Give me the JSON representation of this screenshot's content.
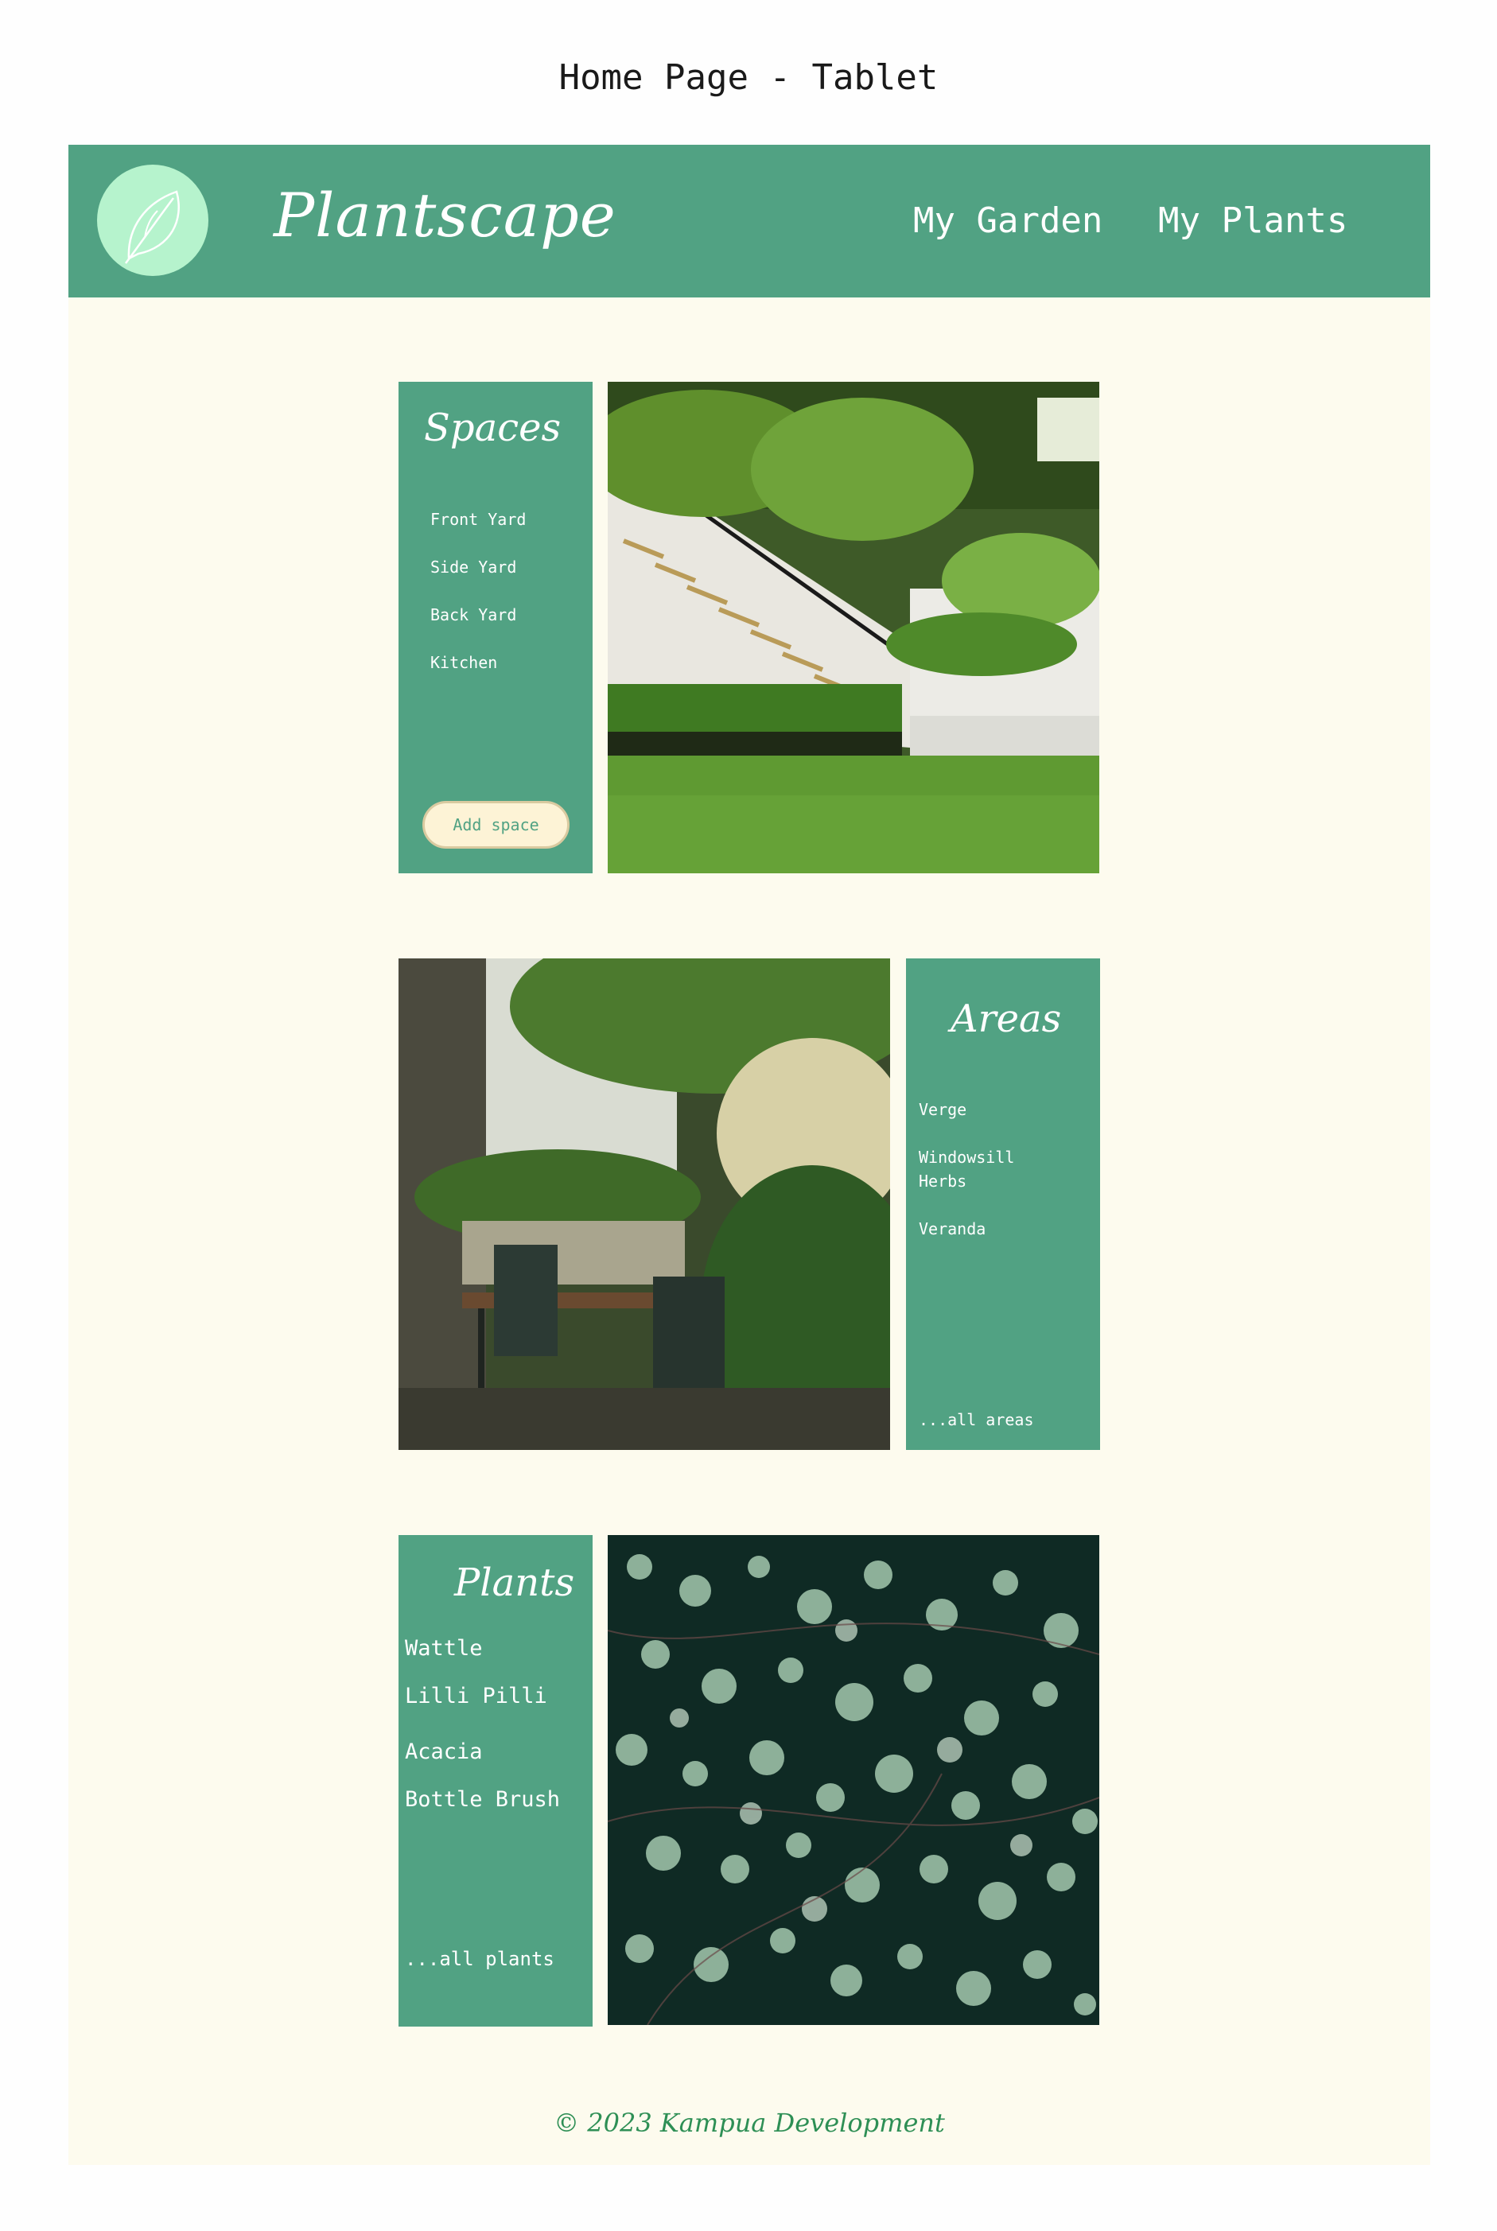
{
  "page_heading": "Home Page - Tablet",
  "header": {
    "brand": "Plantscape",
    "logo_icon": "leaf-icon",
    "nav": [
      {
        "label": "My Garden"
      },
      {
        "label": "My Plants"
      }
    ]
  },
  "spaces": {
    "title": "Spaces",
    "items": [
      "Front Yard",
      "Side Yard",
      "Back Yard",
      "Kitchen"
    ],
    "add_button": "Add space",
    "photo_icon": "garden-stairs-photo"
  },
  "areas": {
    "title": "Areas",
    "items": [
      "Verge",
      "Windowsill",
      "Herbs",
      "Veranda"
    ],
    "more_link": "...all areas",
    "photo_icon": "courtyard-table-photo"
  },
  "plants": {
    "title": "Plants",
    "items": [
      "Wattle",
      "Lilli Pilli",
      "Acacia",
      "Bottle Brush"
    ],
    "more_link": "...all plants",
    "photo_icon": "round-leaves-photo"
  },
  "footer": "© 2023 Kampua Development",
  "colors": {
    "brand_green": "#51a283",
    "logo_mint": "#b6f3cd",
    "page_cream": "#fdfbee",
    "button_cream": "#fdf3d6",
    "footer_green": "#2e8f55"
  }
}
